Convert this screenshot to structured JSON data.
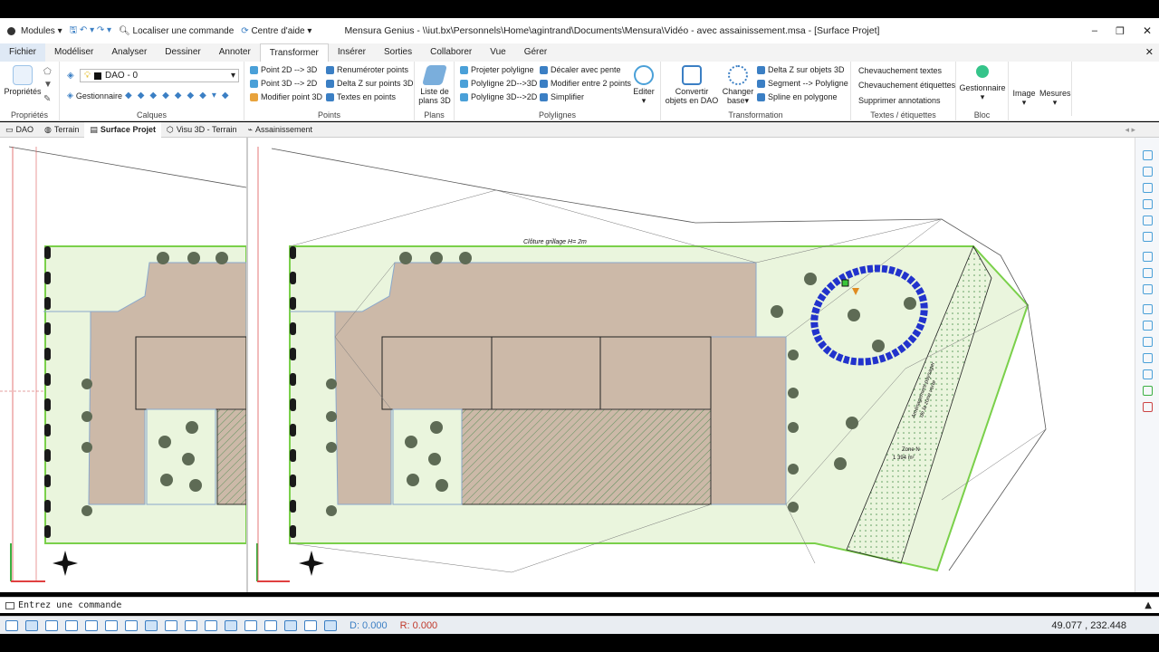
{
  "titlebar": {
    "modules": "Modules",
    "localiser": "Localiser une commande",
    "centre_aide": "Centre d'aide",
    "title": "Mensura Genius - \\\\iut.bx\\Personnels\\Home\\agintrand\\Documents\\Mensura\\Vidéo - avec assainissement.msa - [Surface Projet]"
  },
  "tabs": [
    "Fichier",
    "Modéliser",
    "Analyser",
    "Dessiner",
    "Annoter",
    "Transformer",
    "Insérer",
    "Sorties",
    "Collaborer",
    "Vue",
    "Gérer"
  ],
  "active_tab": "Transformer",
  "ribbon": {
    "proprietes": {
      "button": "Propriétés",
      "label": "Propriétés"
    },
    "calques": {
      "layer_value": "DAO - 0",
      "gestionnaire": "Gestionnaire",
      "label": "Calques"
    },
    "points": {
      "items": [
        "Point 2D --> 3D",
        "Point 3D --> 2D",
        "Modifier point 3D",
        "Renuméroter points",
        "Delta Z sur points 3D",
        "Textes en points"
      ],
      "label": "Points"
    },
    "plans": {
      "button_line1": "Liste de",
      "button_line2": "plans 3D",
      "label": "Plans"
    },
    "polylignes": {
      "items": [
        "Projeter polyligne",
        "Polyligne 2D-->3D",
        "Polyligne 3D-->2D",
        "Décaler avec pente",
        "Modifier entre 2 points",
        "Simplifier"
      ],
      "editer": "Editer",
      "label": "Polylignes"
    },
    "transformation": {
      "convertir_line1": "Convertir",
      "convertir_line2": "objets en DAO",
      "changer_line1": "Changer",
      "changer_line2": "base",
      "items": [
        "Delta Z sur objets 3D",
        "Segment --> Polyligne",
        "Spline en polygone"
      ],
      "label": "Transformation"
    },
    "textes": {
      "items": [
        "Chevauchement textes",
        "Chevauchement étiquettes",
        "Supprimer annotations"
      ],
      "label": "Textes / étiquettes"
    },
    "bloc": {
      "gestionnaire": "Gestionnaire",
      "label": "Bloc"
    },
    "image": "Image",
    "mesures": "Mesures"
  },
  "doc_tabs": [
    "DAO",
    "Terrain",
    "Surface Projet",
    "Visu 3D - Terrain",
    "Assainissement"
  ],
  "active_doc_tab": "Surface Projet",
  "drawing": {
    "label_cloture": "Clôture grillage H= 2m",
    "zone_name": "Zone N",
    "zone_area": "1 394 m²",
    "slope_text_1": "Aménagement paysager",
    "slope_text_2": "de la zone verte"
  },
  "command": {
    "prompt": "Entrez une commande"
  },
  "status": {
    "d_value": "D: 0.000",
    "r_value": "R: 0.000",
    "coords": "49.077 , 232.448"
  },
  "colors": {
    "accent": "#1e6fc0",
    "lawn": "#e9f5dc",
    "building": "#c9b3a2",
    "selection": "#2233cc",
    "hatch": "#5a8f5a"
  }
}
